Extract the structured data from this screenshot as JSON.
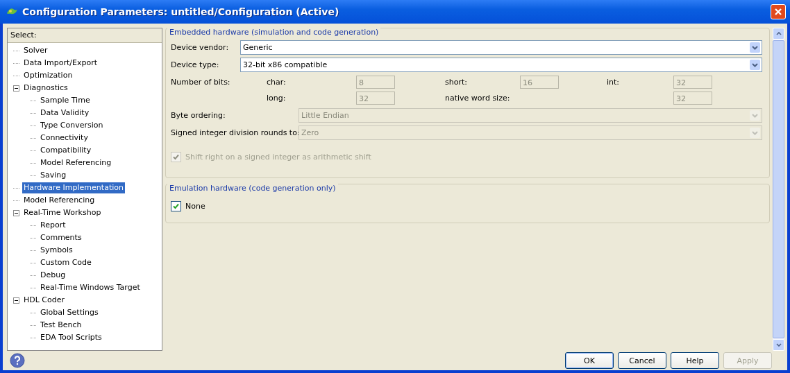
{
  "window": {
    "title": "Configuration Parameters: untitled/Configuration (Active)"
  },
  "tree": {
    "header": "Select:",
    "items": [
      {
        "label": "Solver",
        "selected": false
      },
      {
        "label": "Data Import/Export",
        "selected": false
      },
      {
        "label": "Optimization",
        "selected": false
      },
      {
        "label": "Diagnostics",
        "selected": false,
        "expanded": true,
        "children": [
          {
            "label": "Sample Time",
            "selected": false
          },
          {
            "label": "Data Validity",
            "selected": false
          },
          {
            "label": "Type Conversion",
            "selected": false
          },
          {
            "label": "Connectivity",
            "selected": false
          },
          {
            "label": "Compatibility",
            "selected": false
          },
          {
            "label": "Model Referencing",
            "selected": false
          },
          {
            "label": "Saving",
            "selected": false
          }
        ]
      },
      {
        "label": "Hardware Implementation",
        "selected": true
      },
      {
        "label": "Model Referencing",
        "selected": false
      },
      {
        "label": "Real-Time Workshop",
        "selected": false,
        "expanded": true,
        "children": [
          {
            "label": "Report",
            "selected": false
          },
          {
            "label": "Comments",
            "selected": false
          },
          {
            "label": "Symbols",
            "selected": false
          },
          {
            "label": "Custom Code",
            "selected": false
          },
          {
            "label": "Debug",
            "selected": false
          },
          {
            "label": "Real-Time Windows Target",
            "selected": false
          }
        ]
      },
      {
        "label": "HDL Coder",
        "selected": false,
        "expanded": true,
        "children": [
          {
            "label": "Global Settings",
            "selected": false
          },
          {
            "label": "Test Bench",
            "selected": false
          },
          {
            "label": "EDA Tool Scripts",
            "selected": false
          }
        ]
      }
    ]
  },
  "embedded": {
    "title": "Embedded hardware (simulation and code generation)",
    "device_vendor": {
      "label": "Device vendor:",
      "value": "Generic",
      "disabled": false
    },
    "device_type": {
      "label": "Device type:",
      "value": "32-bit x86 compatible",
      "disabled": false
    },
    "number_of_bits": {
      "label": "Number of bits:",
      "rows": [
        [
          {
            "label": "char:",
            "value": "8"
          },
          {
            "label": "short:",
            "value": "16"
          },
          {
            "label": "int:",
            "value": "32"
          }
        ],
        [
          {
            "label": "long:",
            "value": "32"
          },
          {
            "label": "native word size:",
            "value": "32"
          }
        ]
      ]
    },
    "byte_ordering": {
      "label": "Byte ordering:",
      "value": "Little Endian",
      "disabled": true
    },
    "division": {
      "label": "Signed integer division rounds to:",
      "value": "Zero",
      "disabled": true
    },
    "shift": {
      "label": "Shift right on a signed integer as arithmetic shift",
      "checked": true,
      "disabled": true
    }
  },
  "emulation": {
    "title": "Emulation hardware (code generation only)",
    "none": {
      "label": "None",
      "checked": true,
      "disabled": false
    }
  },
  "buttons": [
    {
      "label": "OK",
      "disabled": false,
      "default": true
    },
    {
      "label": "Cancel",
      "disabled": false,
      "default": false
    },
    {
      "label": "Help",
      "disabled": false,
      "default": false
    },
    {
      "label": "Apply",
      "disabled": true,
      "default": false
    }
  ]
}
